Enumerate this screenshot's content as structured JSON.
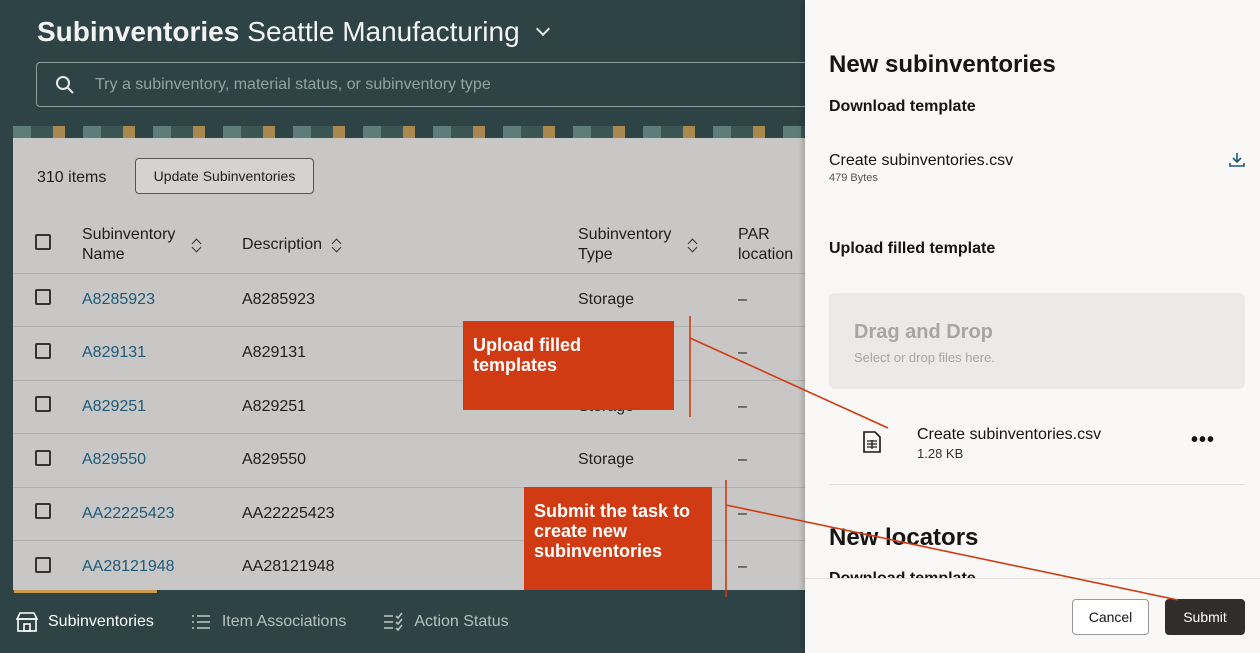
{
  "header": {
    "title_strong": "Subinventories",
    "title_org": "Seattle Manufacturing",
    "search_placeholder": "Try a subinventory, material status, or subinventory type"
  },
  "toolbar": {
    "count": "310 items",
    "update_button": "Update Subinventories"
  },
  "table": {
    "headers": {
      "name": "Subinventory Name",
      "description": "Description",
      "type": "Subinventory Type",
      "par": "PAR location"
    },
    "rows": [
      {
        "name": "A8285923",
        "description": "A8285923",
        "type": "Storage",
        "par": "–"
      },
      {
        "name": "A829131",
        "description": "A829131",
        "type": "",
        "par": "–"
      },
      {
        "name": "A829251",
        "description": "A829251",
        "type": "Storage",
        "par": "–"
      },
      {
        "name": "A829550",
        "description": "A829550",
        "type": "Storage",
        "par": "–"
      },
      {
        "name": "AA22225423",
        "description": "AA22225423",
        "type": "",
        "par": "–"
      },
      {
        "name": "AA28121948",
        "description": "AA28121948",
        "type": "",
        "par": "–"
      }
    ]
  },
  "bottom_nav": [
    {
      "label": "Subinventories",
      "icon": "store-icon",
      "active": true
    },
    {
      "label": "Item Associations",
      "icon": "list-icon",
      "active": false
    },
    {
      "label": "Action Status",
      "icon": "checklist-icon",
      "active": false
    }
  ],
  "drawer": {
    "title": "New subinventories",
    "download_heading": "Download template",
    "template_file": {
      "name": "Create subinventories.csv",
      "size": "479 Bytes"
    },
    "upload_heading": "Upload filled template",
    "drop_title": "Drag and Drop",
    "drop_subtitle": "Select or drop files here.",
    "uploaded_file": {
      "name": "Create subinventories.csv",
      "size": "1.28 KB"
    },
    "more_label": "•••",
    "section2_title": "New locators",
    "section2_sub": "Download template",
    "cancel": "Cancel",
    "submit": "Submit"
  },
  "callouts": {
    "upload": "Upload filled templates",
    "submit": "Submit the task to create new subinventories"
  },
  "colors": {
    "header_bg": "#2e4345",
    "callout": "#d13b13",
    "link": "#1e5a78",
    "submit_bg": "#312d2a"
  }
}
